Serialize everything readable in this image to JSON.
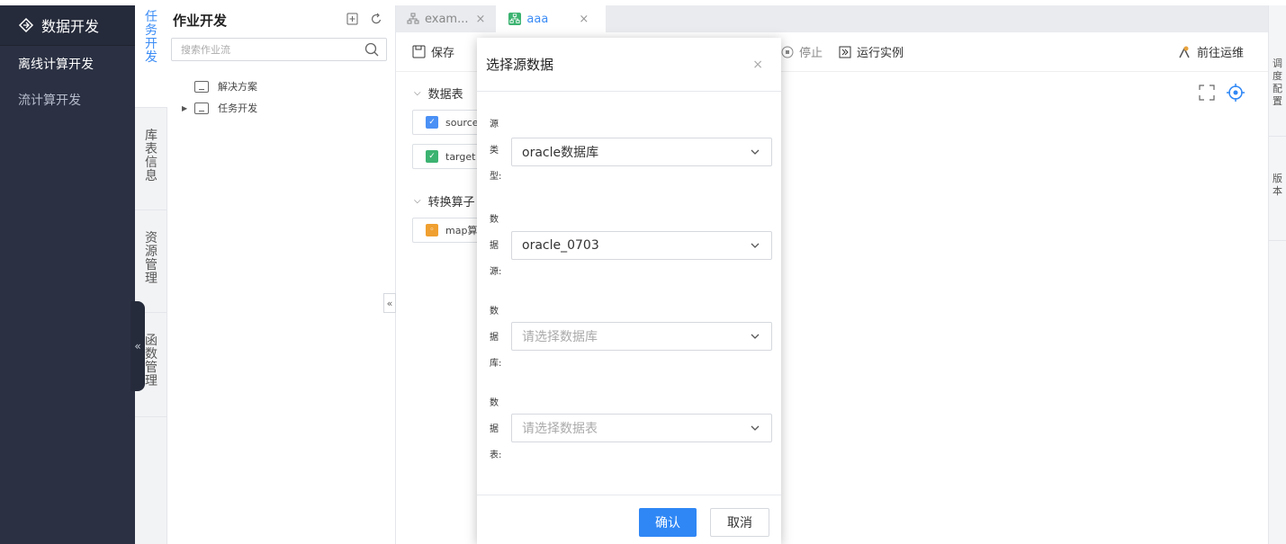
{
  "nav": {
    "title": "数据开发",
    "items": [
      {
        "label": "离线计算开发"
      },
      {
        "label": "流计算开发"
      }
    ],
    "collapse_glyph": "«"
  },
  "vtabs": [
    {
      "label": "任务开发",
      "active": true
    },
    {
      "label": "库表信息",
      "active": false
    },
    {
      "label": "资源管理",
      "active": false
    },
    {
      "label": "函数管理",
      "active": false
    }
  ],
  "tree": {
    "title": "作业开发",
    "search_placeholder": "搜索作业流",
    "nodes": [
      {
        "label": "解决方案"
      },
      {
        "label": "任务开发"
      }
    ],
    "collapse_glyph": "«"
  },
  "tabs": [
    {
      "label": "exam...",
      "close": "×"
    },
    {
      "label": "aaa",
      "close": "×"
    }
  ],
  "toolbar": {
    "save": "保存",
    "stop": "停止",
    "run_instance": "运行实例",
    "goto_ops": "前往运维"
  },
  "left_pane": {
    "section_tables": "数据表",
    "source_card": "source",
    "target_card": "target",
    "section_ops": "转换算子",
    "map_card": "map算"
  },
  "rightbar": {
    "sec1": "调度配置",
    "sec2": "版本"
  },
  "modal": {
    "title": "选择源数据",
    "close": "×",
    "fields": [
      {
        "label": "源类型:",
        "value": "oracle数据库",
        "placeholder": false
      },
      {
        "label": "数据源:",
        "value": "oracle_0703",
        "placeholder": false
      },
      {
        "label": "数据库:",
        "value": "请选择数据库",
        "placeholder": true
      },
      {
        "label": "数据表:",
        "value": "请选择数据表",
        "placeholder": true
      }
    ],
    "confirm": "确认",
    "cancel": "取消"
  },
  "colors": {
    "nav_bg": "#2b3143",
    "accent": "#2f87f5"
  }
}
